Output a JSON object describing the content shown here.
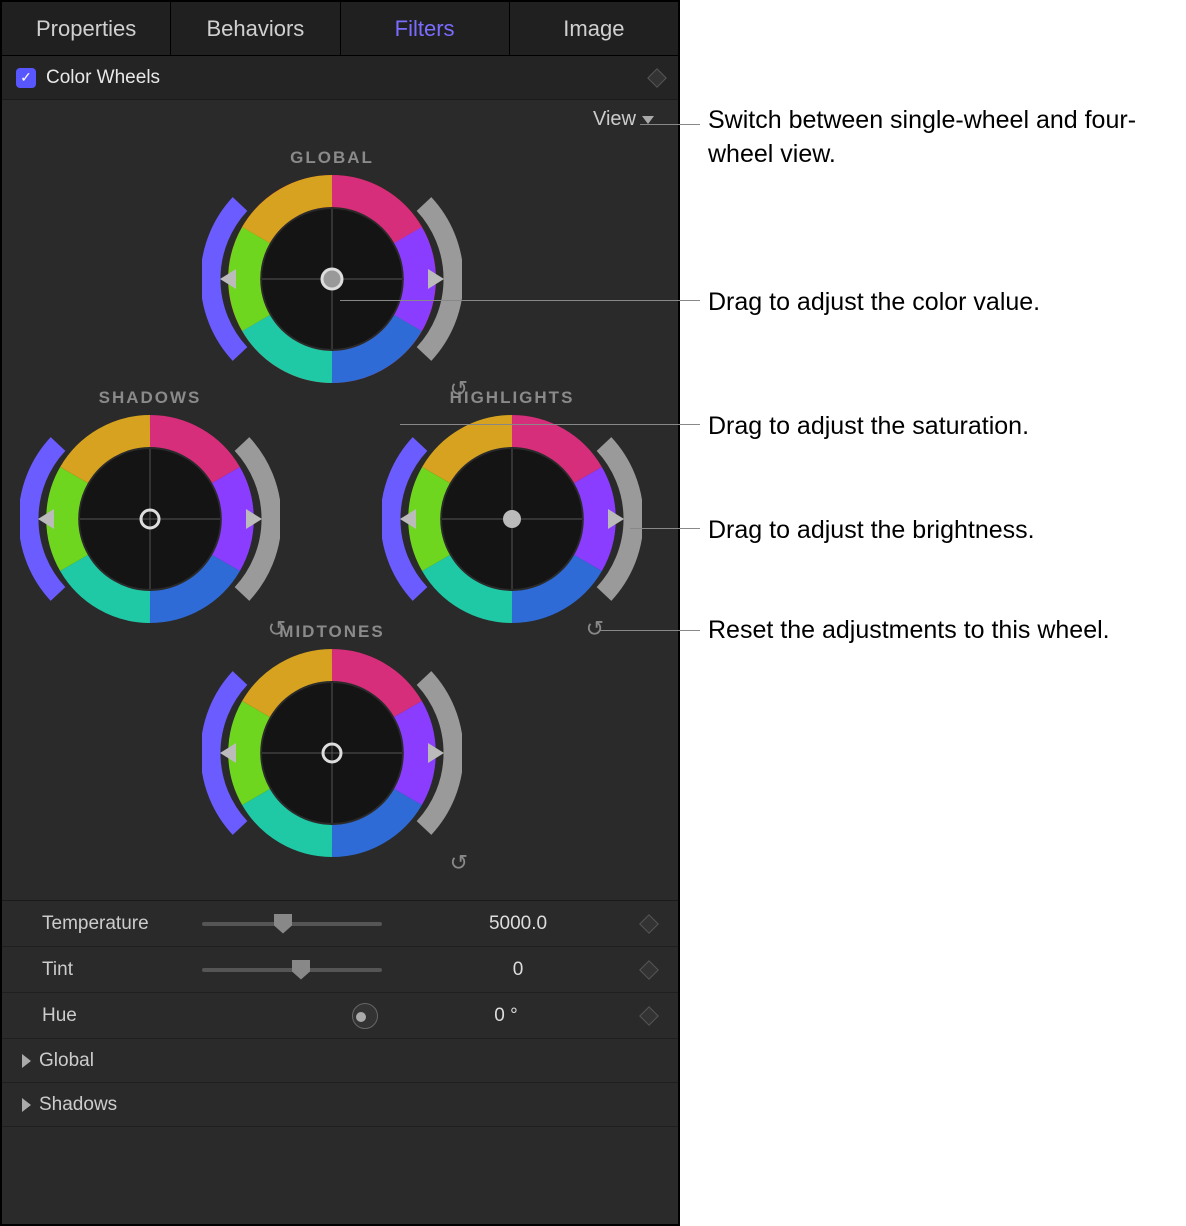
{
  "tabs": [
    "Properties",
    "Behaviors",
    "Filters",
    "Image"
  ],
  "active_tab_index": 2,
  "filter": {
    "name": "Color Wheels",
    "enabled": true
  },
  "view_menu": "View",
  "wheels": {
    "global": {
      "label": "GLOBAL"
    },
    "shadows": {
      "label": "SHADOWS"
    },
    "highlights": {
      "label": "HIGHLIGHTS"
    },
    "midtones": {
      "label": "MIDTONES"
    }
  },
  "params": {
    "temperature": {
      "label": "Temperature",
      "value": "5000.0",
      "slider_pos": 0.4
    },
    "tint": {
      "label": "Tint",
      "value": "0",
      "slider_pos": 0.5
    },
    "hue": {
      "label": "Hue",
      "value": "0 °"
    }
  },
  "rows": {
    "global": "Global",
    "shadows": "Shadows"
  },
  "callouts": {
    "view": "Switch between single-wheel and four-wheel view.",
    "color": "Drag to adjust the color value.",
    "saturation": "Drag to adjust the saturation.",
    "brightness": "Drag to adjust the brightness.",
    "reset": "Reset the adjustments to this wheel."
  }
}
